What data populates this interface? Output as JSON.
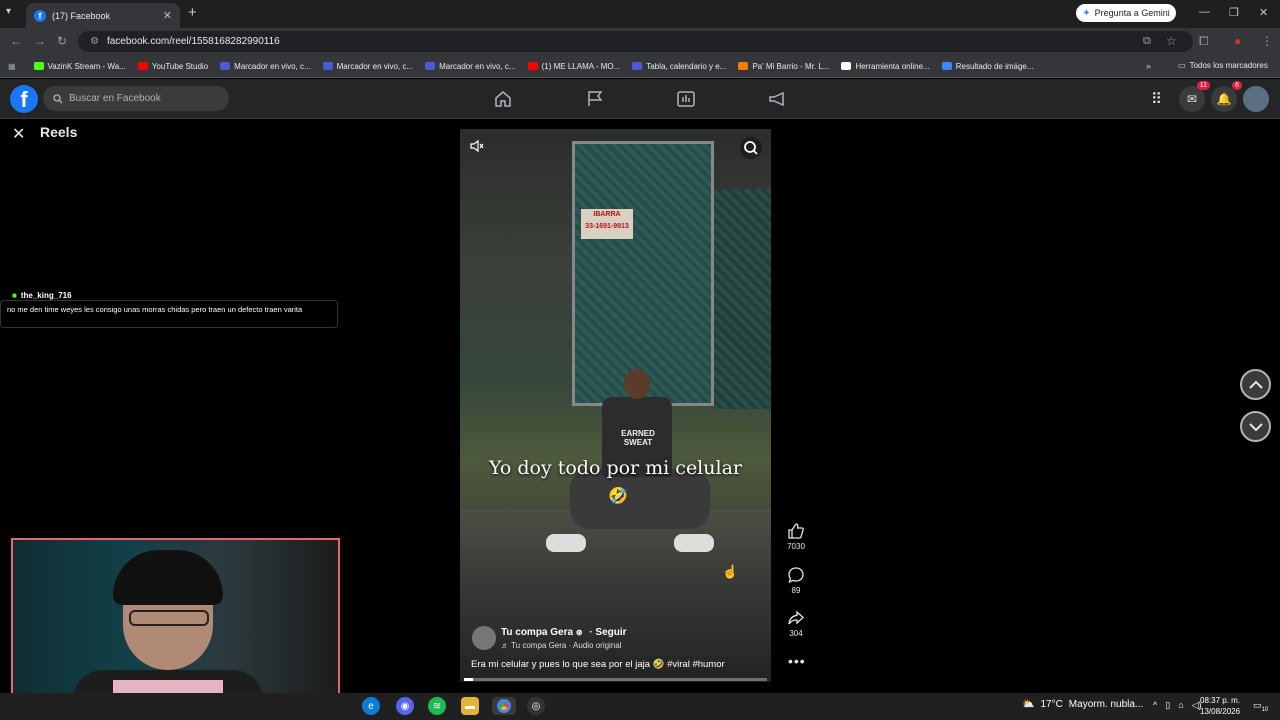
{
  "browser": {
    "tab_title": "(17) Facebook",
    "url": "facebook.com/reel/1558168282990116",
    "gemini_label": "Pregunta a Gemini",
    "bookmarks": [
      {
        "label": "VazinK Stream - Wa...",
        "color": "#53fc18"
      },
      {
        "label": "YouTube Studio",
        "color": "#ff0000"
      },
      {
        "label": "Marcador en vivo, c...",
        "color": "#4b5bd6"
      },
      {
        "label": "Marcador en vivo, c...",
        "color": "#4b5bd6"
      },
      {
        "label": "Marcador en vivo, c...",
        "color": "#4b5bd6"
      },
      {
        "label": "(1) ME LLAMA - MO...",
        "color": "#ff0000"
      },
      {
        "label": "Tabla, calendario y e...",
        "color": "#4b5bd6"
      },
      {
        "label": "Pa' Mi Barrio - Mr. L...",
        "color": "#ff7a00"
      },
      {
        "label": "Herramienta online...",
        "color": "#ffffff"
      },
      {
        "label": "Resultado de imáge...",
        "color": "#4285f4"
      }
    ],
    "all_bookmarks": "Todos los marcadores"
  },
  "facebook": {
    "search_placeholder": "Buscar en Facebook",
    "messenger_badge": "11",
    "notifications_badge": "6"
  },
  "reels": {
    "title": "Reels",
    "overlay_text": "Yo doy todo por mi celular",
    "overlay_emoji": "🤣",
    "sign_text": "IBARRA\n33-1691-9913",
    "shirt_text": "EARNED\nSWEAT",
    "author": "Tu compa Gera",
    "follow": "· Seguir",
    "audio": "Tu compa Gera · Audio original",
    "post_text": "Era mi celular y pues lo que sea por el jaja 🤣 #viral #humor",
    "progress": 0.03,
    "likes": "7030",
    "comments": "89",
    "shares": "304"
  },
  "chat": {
    "username": "the_king_716",
    "message": "no me den time weyes les consigo unas morras chidas pero traen un defecto traen varita"
  },
  "taskbar": {
    "temperature": "17°C",
    "weather_text": "Mayorm. nubla...",
    "time": "08:37 p. m.",
    "date": "13/08/2026",
    "notif_count": "10"
  }
}
